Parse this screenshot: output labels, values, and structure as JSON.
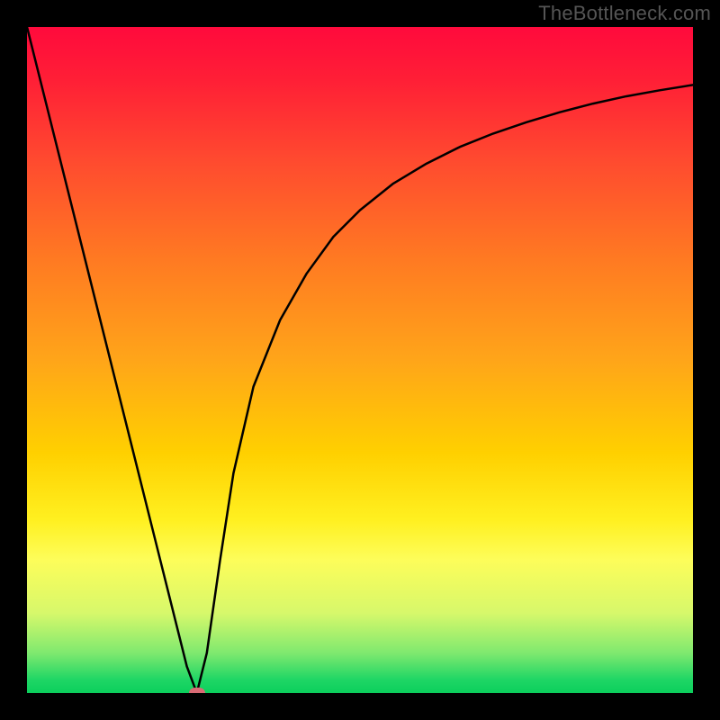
{
  "watermark": "TheBottleneck.com",
  "chart_data": {
    "type": "line",
    "title": "",
    "xlabel": "",
    "ylabel": "",
    "xlim": [
      0,
      100
    ],
    "ylim": [
      0,
      100
    ],
    "x": [
      0,
      4,
      8,
      12,
      16,
      20,
      24,
      25.5,
      27,
      29,
      31,
      34,
      38,
      42,
      46,
      50,
      55,
      60,
      65,
      70,
      75,
      80,
      85,
      90,
      95,
      100
    ],
    "y": [
      100,
      84,
      68,
      52,
      36,
      20,
      4,
      0,
      6,
      20,
      33,
      46,
      56,
      63,
      68.5,
      72.5,
      76.5,
      79.5,
      82,
      84,
      85.7,
      87.2,
      88.5,
      89.6,
      90.5,
      91.3
    ],
    "min_point": {
      "x": 25.5,
      "y": 0
    },
    "grid": false,
    "legend": false
  },
  "colors": {
    "curve": "#000000",
    "marker": "#d96a74",
    "background_top": "#ff0a3c",
    "background_bottom": "#0bcf5c"
  }
}
